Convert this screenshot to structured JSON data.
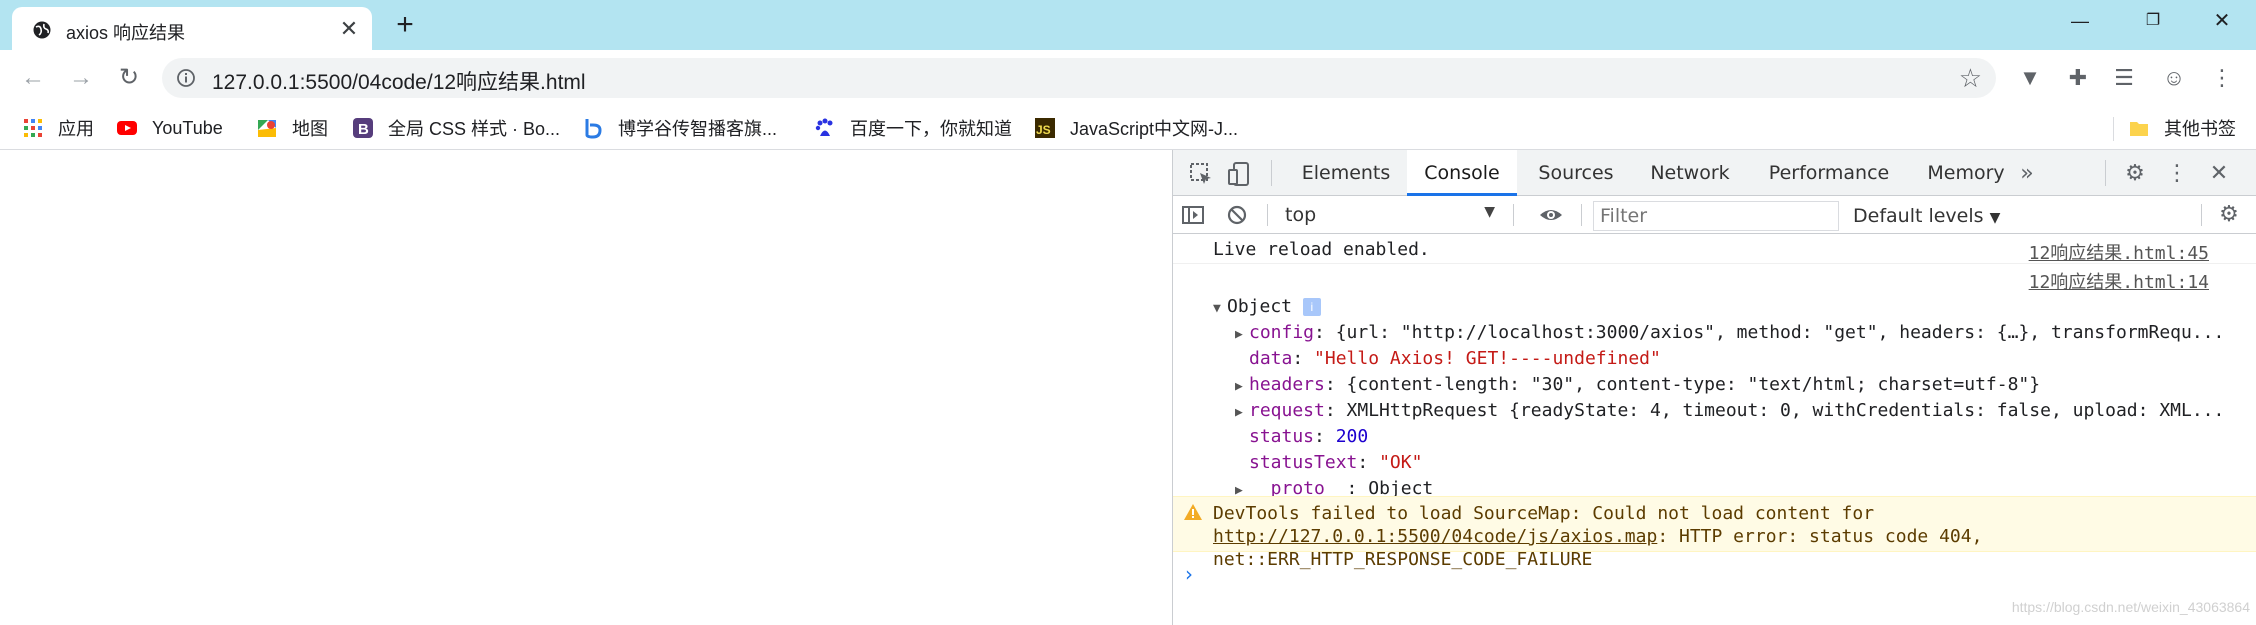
{
  "browser": {
    "tab_title": "axios 响应结果",
    "url": "127.0.0.1:5500/04code/12响应结果.html",
    "colors": {
      "tabstrip": "#b3e4f1",
      "accent": "#1a73e8"
    }
  },
  "bookmarks": [
    {
      "label": "应用",
      "icon": "apps-grid-icon"
    },
    {
      "label": "YouTube",
      "icon": "youtube-icon"
    },
    {
      "label": "地图",
      "icon": "maps-icon"
    },
    {
      "label": "全局 CSS 样式 · Bo...",
      "icon": "bootstrap-icon"
    },
    {
      "label": "博学谷传智播客旗...",
      "icon": "boxuegu-icon"
    },
    {
      "label": "百度一下，你就知道",
      "icon": "baidu-icon"
    },
    {
      "label": "JavaScript中文网-J...",
      "icon": "js-icon"
    },
    {
      "label": "其他书签",
      "icon": "folder-icon"
    }
  ],
  "devtools": {
    "tabs": [
      "Elements",
      "Console",
      "Sources",
      "Network",
      "Performance",
      "Memory"
    ],
    "active_tab": "Console",
    "context": "top",
    "filter_placeholder": "Filter",
    "levels": "Default levels",
    "logs": [
      {
        "text": "Live reload enabled.",
        "source": "12响应结果.html:45"
      },
      {
        "text": "",
        "source": "12响应结果.html:14"
      }
    ],
    "object": {
      "label": "Object",
      "info": "i",
      "config_key": "config",
      "config_val": "{url: \"http://localhost:3000/axios\", method: \"get\", headers: {…}, transformRequ...",
      "data_key": "data",
      "data_val": "\"Hello Axios! GET!----undefined\"",
      "headers_key": "headers",
      "headers_val": "{content-length: \"30\", content-type: \"text/html; charset=utf-8\"}",
      "request_key": "request",
      "request_val": "XMLHttpRequest {readyState: 4, timeout: 0, withCredentials: false, upload: XML...",
      "status_key": "status",
      "status_val": "200",
      "statusText_key": "statusText",
      "statusText_val": "\"OK\"",
      "proto_key": "__proto__",
      "proto_val": "Object"
    },
    "warning": {
      "prefix": "DevTools failed to load SourceMap: Could not load content for ",
      "link": "http://127.0.0.1:5500/04code/js/axios.map",
      "suffix": ": HTTP error: status code 404, net::ERR_HTTP_RESPONSE_CODE_FAILURE"
    },
    "prompt": "›"
  },
  "watermark": "https://blog.csdn.net/weixin_43063864"
}
